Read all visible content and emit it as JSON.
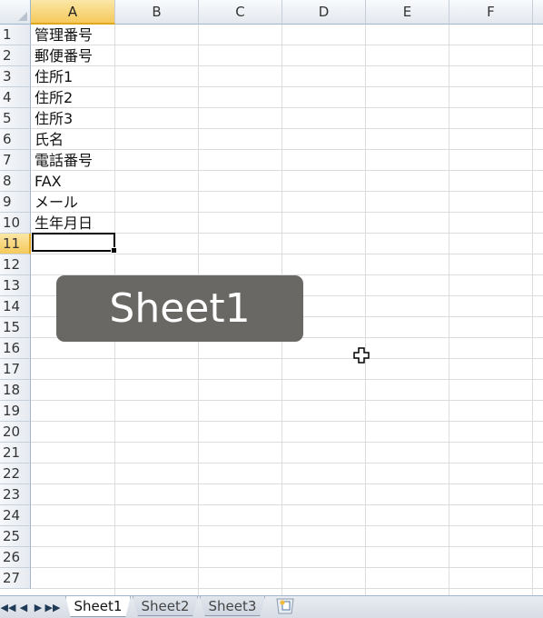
{
  "columns": [
    "A",
    "B",
    "C",
    "D",
    "E",
    "F"
  ],
  "rows": [
    "1",
    "2",
    "3",
    "4",
    "5",
    "6",
    "7",
    "8",
    "9",
    "10",
    "11",
    "12",
    "13",
    "14",
    "15",
    "16",
    "17",
    "18",
    "19",
    "20",
    "21",
    "22",
    "23",
    "24",
    "25",
    "26",
    "27"
  ],
  "cells": {
    "a1": "管理番号",
    "a2": "郵便番号",
    "a3": "住所1",
    "a4": "住所2",
    "a5": "住所3",
    "a6": "氏名",
    "a7": "電話番号",
    "a8": "FAX",
    "a9": "メール",
    "a10": "生年月日",
    "a11": ""
  },
  "active_cell": "A11",
  "overlay_label": "Sheet1",
  "tabs": [
    "Sheet1",
    "Sheet2",
    "Sheet3"
  ],
  "active_tab": "Sheet1",
  "nav": {
    "first": "◀◀",
    "prev": "◀",
    "next": "▶",
    "last": "▶▶"
  },
  "colors": {
    "selection_header": "#f5c95b",
    "gridline": "#dadcdd",
    "overlay_bg": "#5f5c58"
  }
}
